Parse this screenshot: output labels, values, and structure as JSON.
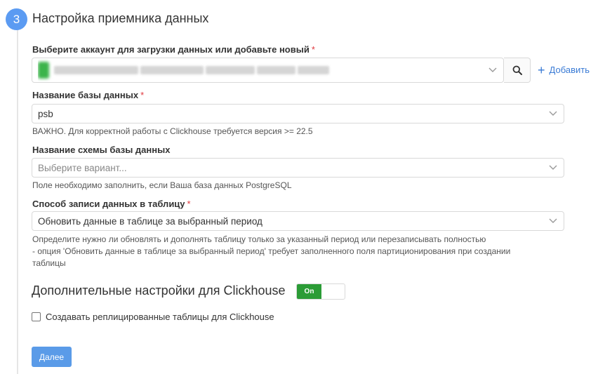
{
  "step": {
    "number": "3",
    "title": "Настройка приемника данных"
  },
  "account": {
    "label": "Выберите аккаунт для загрузки данных или добавьте новый",
    "required": "*",
    "add_label": "Добавить"
  },
  "database": {
    "label": "Название базы данных",
    "required": "*",
    "value": "psb",
    "hint": "ВАЖНО. Для корректной работы с Clickhouse требуется версия >= 22.5"
  },
  "schema": {
    "label": "Название схемы базы данных",
    "placeholder": "Выберите вариант...",
    "hint": "Поле необходимо заполнить, если Ваша база данных PostgreSQL"
  },
  "write_mode": {
    "label": "Способ записи данных в таблицу",
    "required": "*",
    "value": "Обновить данные в таблице за выбранный период",
    "hint_line1": "Определите нужно ли обновлять и дополнять таблицу только за указанный период или перезаписывать полностью",
    "hint_line2": "- опция 'Обновить данные в таблице за выбранный период' требует заполненного поля партиционирования при создании",
    "hint_line3": "таблицы"
  },
  "advanced": {
    "title": "Дополнительные настройки для Clickhouse",
    "toggle_label": "On",
    "checkbox_label": "Создавать реплицированные таблицы для Clickhouse"
  },
  "actions": {
    "next_label": "Далее"
  },
  "colors": {
    "accent": "#5b9bf2",
    "link": "#3a7bd5",
    "toggle_on": "#2b9c36",
    "required": "#e0383e"
  }
}
